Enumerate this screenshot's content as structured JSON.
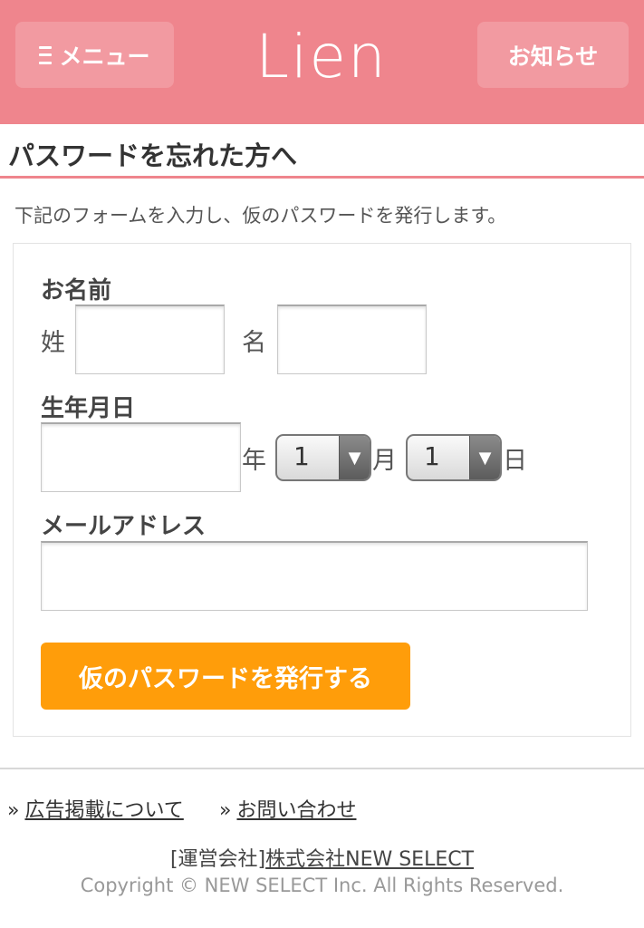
{
  "header": {
    "menu_label": "メニュー",
    "menu_icon": "hamburger-icon",
    "logo_text": "Lien",
    "news_label": "お知らせ",
    "background_color": "#ef858d",
    "button_color": "#f29aa1"
  },
  "page": {
    "title": "パスワードを忘れた方へ",
    "description": "下記のフォームを入力し、仮のパスワードを発行します。"
  },
  "form": {
    "name_label": "お名前",
    "last_name_label": "姓",
    "last_name_value": "",
    "first_name_label": "名",
    "first_name_value": "",
    "birthday_label": "生年月日",
    "year_value": "",
    "year_unit": "年",
    "month_value": "1",
    "month_unit": "月",
    "day_value": "1",
    "day_unit": "日",
    "email_label": "メールアドレス",
    "email_value": "",
    "submit_label": "仮のパスワードを発行する",
    "submit_color": "#ff9d0a"
  },
  "footer": {
    "links": [
      {
        "chevron": "»",
        "label": "広告掲載について"
      },
      {
        "chevron": "»",
        "label": "お問い合わせ"
      }
    ],
    "operator_prefix": "[運営会社]",
    "operator_company": "株式会社NEW SELECT",
    "copyright": "Copyright © NEW SELECT Inc. All Rights Reserved."
  }
}
